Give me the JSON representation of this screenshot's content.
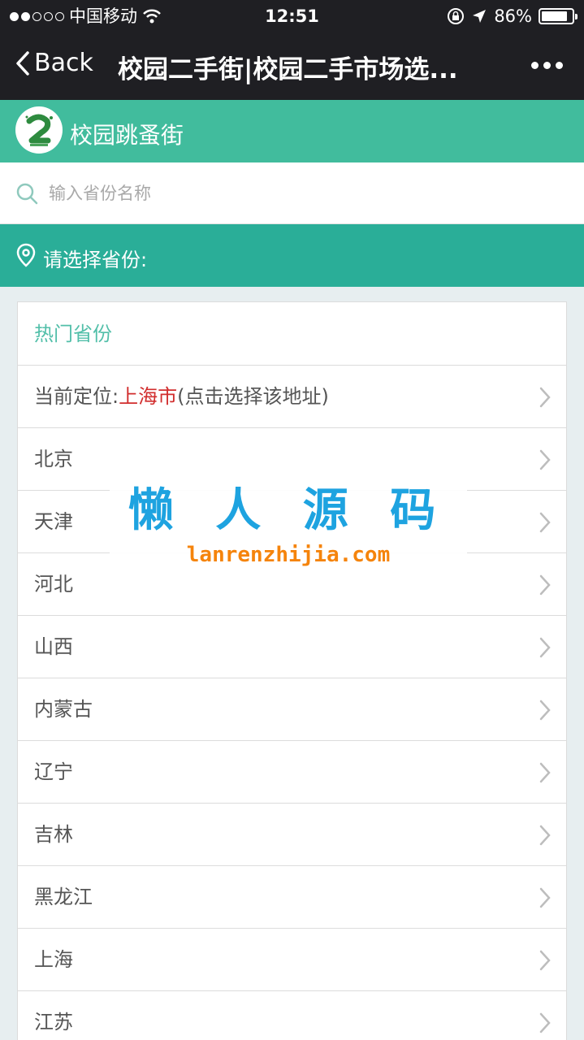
{
  "status": {
    "carrier": "中国移动",
    "time": "12:51",
    "battery": "86%",
    "battery_level": 0.86
  },
  "nav": {
    "back_label": "Back",
    "title": "校园二手街|校园二手市场选..."
  },
  "header": {
    "app_name": "校园跳蚤街"
  },
  "search": {
    "placeholder": "输入省份名称"
  },
  "select_bar": {
    "label": "请选择省份:"
  },
  "list": {
    "heading": "热门省份",
    "current_prefix": "当前定位:",
    "current_city": "上海市",
    "current_suffix": "(点击选择该地址)",
    "provinces": [
      "北京",
      "天津",
      "河北",
      "山西",
      "内蒙古",
      "辽宁",
      "吉林",
      "黑龙江",
      "上海",
      "江苏"
    ]
  },
  "watermark": {
    "title": "懒 人 源 码",
    "url": "lanrenzhijia.com"
  },
  "colors": {
    "header_green": "#41bc9d",
    "select_green": "#2aae98",
    "heading_text": "#52bfa9",
    "highlight_red": "#d12d2d"
  }
}
